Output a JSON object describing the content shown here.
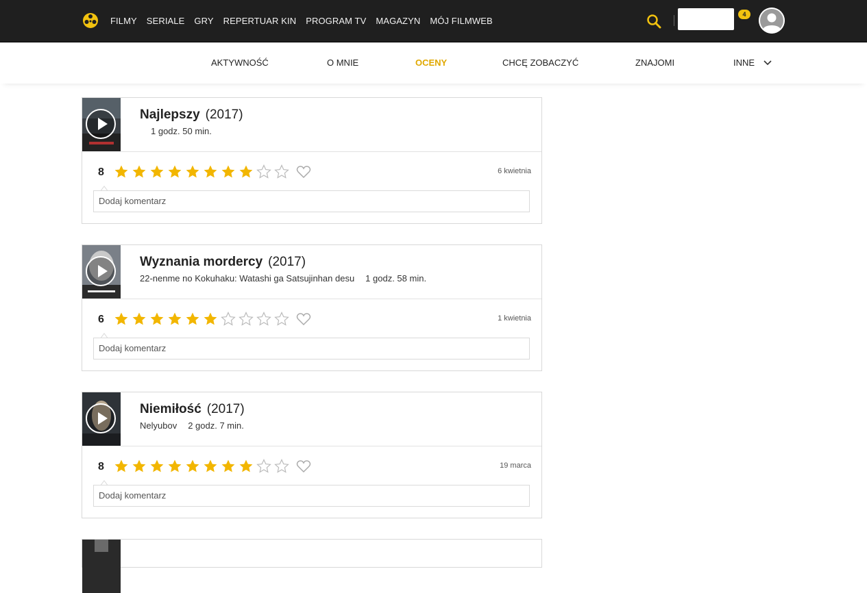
{
  "nav": {
    "menu": [
      "FILMY",
      "SERIALE",
      "GRY",
      "REPERTUAR KIN",
      "PROGRAM TV",
      "MAGAZYN",
      "MÓJ FILMWEB"
    ],
    "notification_count": "4"
  },
  "tabs": {
    "items": [
      "AKTYWNOŚĆ",
      "O MNIE",
      "OCENY",
      "CHCĘ ZOBACZYĆ",
      "ZNAJOMI",
      "INNE"
    ],
    "active": "OCENY"
  },
  "ratings": [
    {
      "title": "Najlepszy",
      "year": "(2017)",
      "original_title": "",
      "duration": "1 godz. 50 min.",
      "rating": 8,
      "rating_label": "8",
      "date": "6 kwietnia",
      "comment_placeholder": "Dodaj komentarz"
    },
    {
      "title": "Wyznania mordercy",
      "year": "(2017)",
      "original_title": "22-nenme no Kokuhaku: Watashi ga Satsujinhan desu",
      "duration": "1 godz. 58 min.",
      "rating": 6,
      "rating_label": "6",
      "date": "1 kwietnia",
      "comment_placeholder": "Dodaj komentarz"
    },
    {
      "title": "Niemiłość",
      "year": "(2017)",
      "original_title": "Nelyubov",
      "duration": "2 godz. 7 min.",
      "rating": 8,
      "rating_label": "8",
      "date": "19 marca",
      "comment_placeholder": "Dodaj komentarz"
    }
  ],
  "colors": {
    "accent": "#e0a800",
    "star_filled": "#f2b600",
    "star_empty": "#bbbbbb",
    "nav_bg": "#1f1f1f"
  }
}
